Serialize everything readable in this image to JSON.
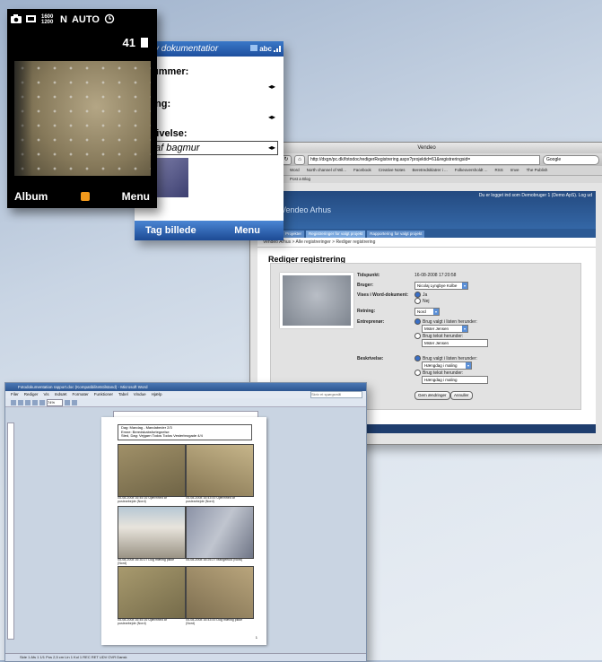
{
  "camera_phone": {
    "res_top": "1600",
    "res_bottom": "1200",
    "flag_n": "N",
    "flag_auto": "AUTO",
    "shots_left": "41",
    "left_softkey": "Album",
    "right_softkey": "Menu",
    "accent_color": "#f39a1c"
  },
  "form_phone": {
    "title": "y dokumentatior",
    "input_mode": "abc",
    "field_1": "ummer:",
    "field_2": "ing:",
    "field_3": "rivelse:",
    "description_value": "af bagmur",
    "left_softkey": "Tag billede",
    "right_softkey": "Menu"
  },
  "browser": {
    "window_title": "Vendeo",
    "url": "http://dxgn/pc.dk/fotodoc/redigerRegistrering.aspx?projektid=61&registreringsid=",
    "search_placeholder": "Google",
    "bookmarks": [
      "Word",
      "North channel of Wil...",
      "Facebook",
      "Creative Notes",
      "Beretredsklatrer i ...",
      "Folkeoversholdt ...",
      "RSS",
      "Imve",
      "The Publish"
    ],
    "bookmarks2": "Post a Blog",
    "site": {
      "login_text": "Du er logget ind som Demobruger 1 (Demo ApS). Log ud",
      "logo_text": "Vendeo Arhus",
      "tabs": [
        "Projekter",
        "Registreringer for valgt projekt",
        "Rapportering for valgt projekt"
      ],
      "breadcrumb": "Vendeo Arhus > Alle registreringer > Rediger registrering",
      "page_title": "Rediger registrering",
      "form": {
        "label_time": "Tidspunkt:",
        "value_time": "16-08-2008 17:20:58",
        "label_user": "Bruger:",
        "value_user": "Nicolaj Lyngbye Kolbe",
        "label_show": "Vises i Word-dokument:",
        "opt_yes": "Ja",
        "opt_no": "Nej",
        "label_dir": "Retning:",
        "value_dir": "Nord",
        "label_contractor": "Entreprenør:",
        "opt_list": "Brug valgt i listen herunder:",
        "value_contractor_select": "Mster Jensen",
        "opt_text": "Brug tekst herunder:",
        "value_contractor_text": "Mster Jensen",
        "label_desc": "Beskrivelse:",
        "value_desc_select": "Hængdag i maling",
        "value_desc_text": "Hængdag i maling",
        "save_button": "Gem ændringer",
        "cancel_button": "Annuller"
      }
    }
  },
  "word": {
    "window_title": "Fotodokumentation rapport.doc (Kompatibilitetstilstand) - Microsoft Word",
    "menus": [
      "Filer",
      "Rediger",
      "Vis",
      "Indsæt",
      "Formater",
      "Funktioner",
      "Tabel",
      "Vindue",
      "Hjælp"
    ],
    "help_placeholder": "Skriv et spørgsmål",
    "zoom": "74%",
    "header_lines": [
      "Dag:      Mandag - Mandabeder 2/3",
      "Emne:    Beredskabsfortegnelse",
      "Sted, Dag:   Vejgarn Todos Todos Vesterbrogade 4/4"
    ],
    "captions": [
      "05-08-2008 16:45:16 Ujævnhed af puslearbejde (Nord)",
      "05-08-2008 16:43:00 Ujævnhed af puslearbejde (Nord)",
      "05-08-2008 16:30:27 Dog mæling pikke (Nord)",
      "05-08-2008 16:25:27 Mangelfuld (Nord)",
      "05-08-2008 16:45:16 Ujævnhed af puslearbejde (Nord)",
      "05-08-2008 16:43:00 Dog mæling pikke (Nord)"
    ],
    "page_number": "1",
    "status": "Side 1   Afs 1   1/1   Pos 2,5 cm   Lin 1   Kol 1   REC  RET  UDV  OVR   Dansk"
  }
}
